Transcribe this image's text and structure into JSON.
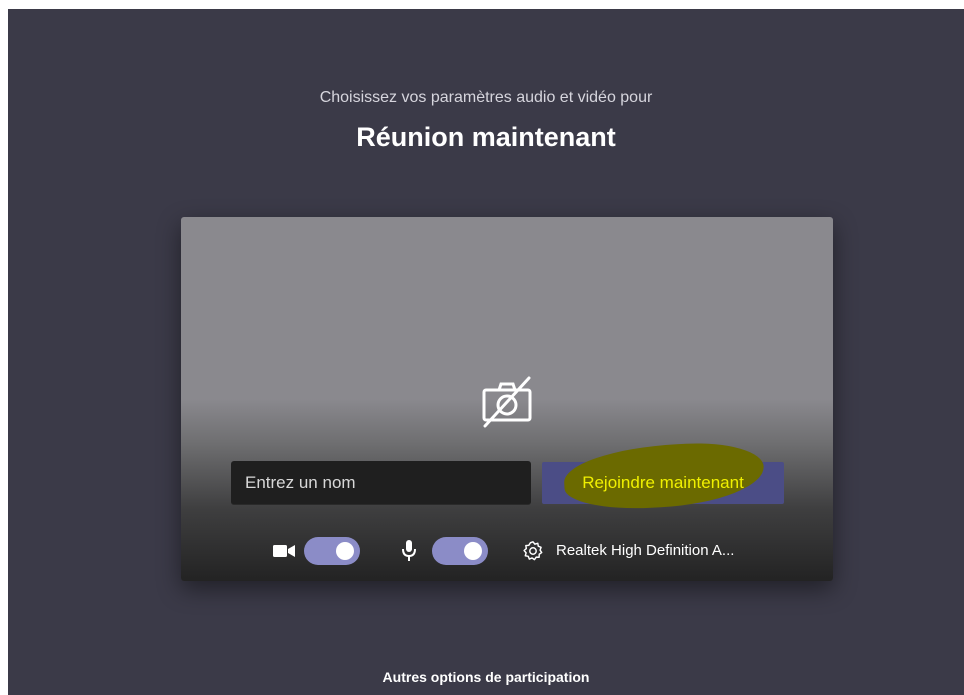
{
  "header": {
    "subtitle": "Choisissez vos paramètres audio et vidéo pour",
    "meeting_title": "Réunion maintenant"
  },
  "preview": {
    "camera_state_icon": "camera-off-icon",
    "name_input": {
      "placeholder": "Entrez un nom",
      "value": ""
    },
    "join_label": "Rejoindre maintenant"
  },
  "controls": {
    "camera": {
      "icon": "video-camera-icon",
      "enabled": true
    },
    "microphone": {
      "icon": "microphone-icon",
      "enabled": true
    },
    "audio_device": {
      "icon": "gear-icon",
      "label": "Realtek High Definition A..."
    }
  },
  "footer": {
    "other_options_label": "Autres options de participation"
  },
  "colors": {
    "background": "#3b3a48",
    "toggle_on": "#8b8cc7",
    "join_button": "#4b4d86",
    "highlight": "#6b6a00",
    "highlight_text": "#f0f000"
  }
}
